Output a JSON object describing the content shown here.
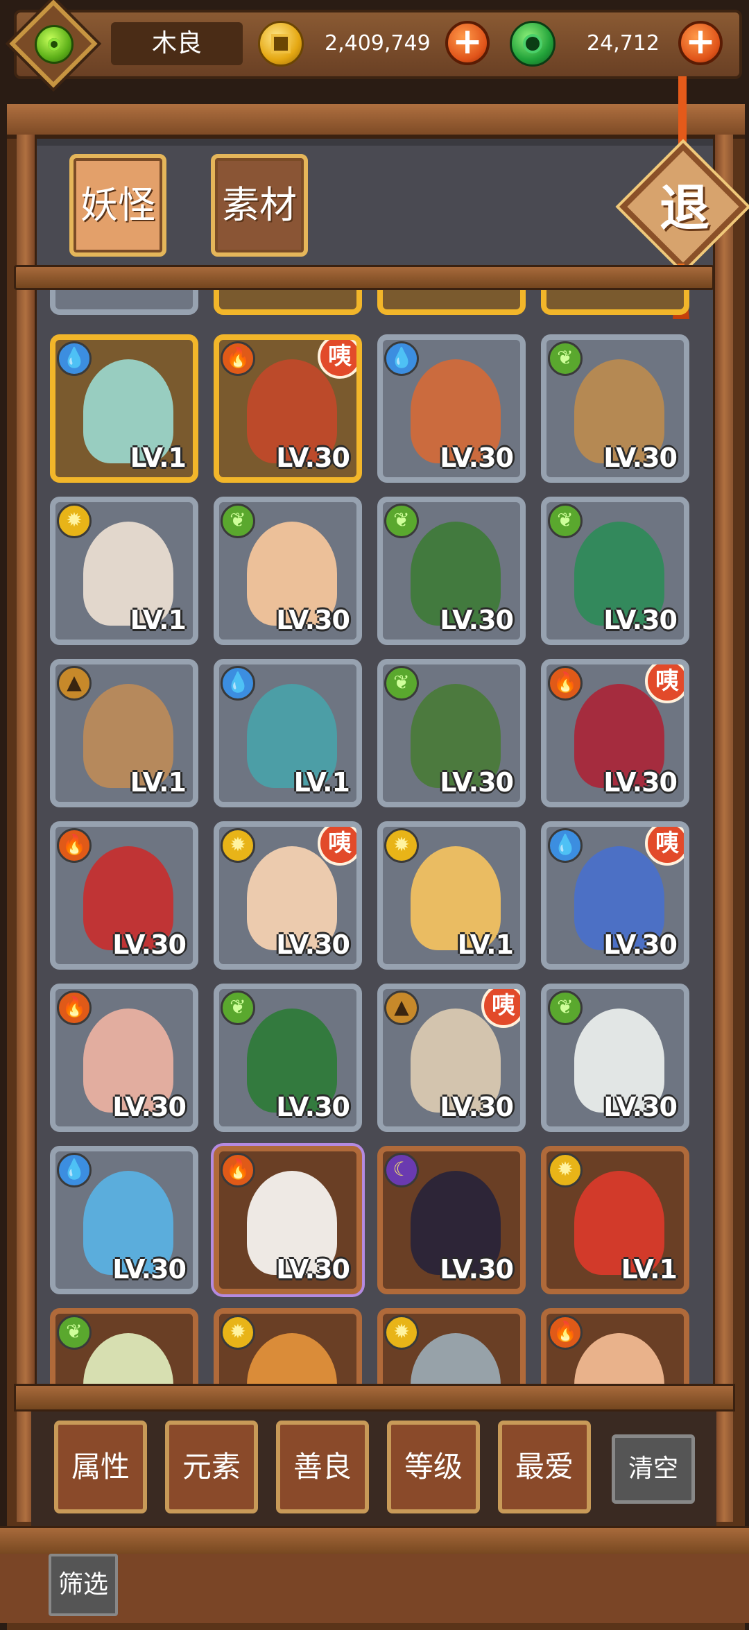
{
  "player": {
    "name": "木良",
    "gold": "2,409,749",
    "jade": "24,712",
    "plus": "+"
  },
  "tabs": [
    {
      "label": "妖怪",
      "active": true
    },
    {
      "label": "素材",
      "active": false
    }
  ],
  "exit_label": "退",
  "cards": [
    {
      "level": "LV.1",
      "element": "water",
      "frame": "gold",
      "portrait": "#9ad4c8",
      "badge": ""
    },
    {
      "level": "LV.30",
      "element": "fire",
      "frame": "gold",
      "portrait": "#c04a2a",
      "badge": "咦"
    },
    {
      "level": "LV.30",
      "element": "water",
      "frame": "silver",
      "portrait": "#d06a3a",
      "badge": ""
    },
    {
      "level": "LV.30",
      "element": "leaf",
      "frame": "silver",
      "portrait": "#b88a50",
      "badge": ""
    },
    {
      "level": "LV.1",
      "element": "sun",
      "frame": "silver",
      "portrait": "#e8dcd0",
      "badge": ""
    },
    {
      "level": "LV.30",
      "element": "leaf",
      "frame": "silver",
      "portrait": "#f2c49a",
      "badge": ""
    },
    {
      "level": "LV.30",
      "element": "leaf",
      "frame": "silver",
      "portrait": "#3f7a3a",
      "badge": ""
    },
    {
      "level": "LV.30",
      "element": "leaf",
      "frame": "silver",
      "portrait": "#2f8a5a",
      "badge": ""
    },
    {
      "level": "LV.1",
      "element": "earth",
      "frame": "silver",
      "portrait": "#b98a5a",
      "badge": ""
    },
    {
      "level": "LV.1",
      "element": "water",
      "frame": "silver",
      "portrait": "#4aa0a8",
      "badge": ""
    },
    {
      "level": "LV.30",
      "element": "leaf",
      "frame": "silver",
      "portrait": "#4a7a3a",
      "badge": ""
    },
    {
      "level": "LV.30",
      "element": "fire",
      "frame": "silver",
      "portrait": "#a8283a",
      "badge": "咦"
    },
    {
      "level": "LV.30",
      "element": "fire",
      "frame": "silver",
      "portrait": "#c43030",
      "badge": ""
    },
    {
      "level": "LV.30",
      "element": "sun",
      "frame": "silver",
      "portrait": "#f2d0b0",
      "badge": "咦"
    },
    {
      "level": "LV.1",
      "element": "sun",
      "frame": "silver",
      "portrait": "#f0c060",
      "badge": ""
    },
    {
      "level": "LV.30",
      "element": "water",
      "frame": "silver",
      "portrait": "#4a70c8",
      "badge": "咦"
    },
    {
      "level": "LV.30",
      "element": "fire",
      "frame": "silver",
      "portrait": "#e8b0a0",
      "badge": ""
    },
    {
      "level": "LV.30",
      "element": "leaf",
      "frame": "silver",
      "portrait": "#2f7a3a",
      "badge": ""
    },
    {
      "level": "LV.30",
      "element": "earth",
      "frame": "silver",
      "portrait": "#d8c8b0",
      "badge": "咦"
    },
    {
      "level": "LV.30",
      "element": "leaf",
      "frame": "silver",
      "portrait": "#e8ecea",
      "badge": ""
    },
    {
      "level": "LV.30",
      "element": "water",
      "frame": "silver",
      "portrait": "#5ab0e0",
      "badge": ""
    },
    {
      "level": "LV.30",
      "element": "fire",
      "frame": "brown",
      "portrait": "#f6f2ee",
      "badge": "",
      "selected": true
    },
    {
      "level": "LV.30",
      "element": "moon",
      "frame": "brown",
      "portrait": "#2a2438",
      "badge": ""
    },
    {
      "level": "LV.1",
      "element": "sun",
      "frame": "brown",
      "portrait": "#d83a2a",
      "badge": ""
    },
    {
      "level": "",
      "element": "leaf",
      "frame": "brown",
      "portrait": "#dde8b8",
      "badge": ""
    },
    {
      "level": "",
      "element": "sun",
      "frame": "brown",
      "portrait": "#e0903a",
      "badge": ""
    },
    {
      "level": "",
      "element": "sun",
      "frame": "brown",
      "portrait": "#9aa8b0",
      "badge": ""
    },
    {
      "level": "",
      "element": "fire",
      "frame": "brown",
      "portrait": "#f0b890",
      "badge": ""
    }
  ],
  "element_glyphs": {
    "water": "💧",
    "fire": "🔥",
    "leaf": "❦",
    "sun": "✹",
    "earth": "▲",
    "moon": "☾"
  },
  "filters": {
    "buttons": [
      "属性",
      "元素",
      "善良",
      "等级",
      "最爱"
    ],
    "clear": "清空",
    "sieve": "筛选"
  }
}
